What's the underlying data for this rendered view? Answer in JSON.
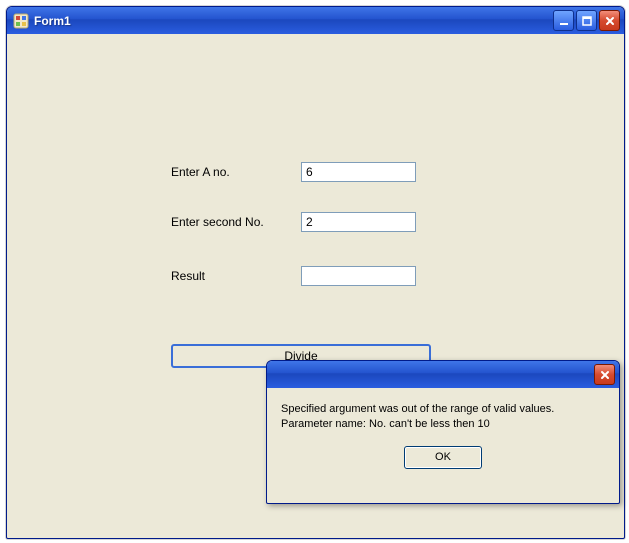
{
  "window": {
    "title": "Form1",
    "icons": {
      "app": "winforms-app-icon",
      "minimize": "minimize-icon",
      "maximize": "maximize-icon",
      "close": "close-icon"
    }
  },
  "form": {
    "rowA": {
      "label": "Enter A no.",
      "value": "6"
    },
    "rowB": {
      "label": "Enter second No.",
      "value": "2"
    },
    "rowResult": {
      "label": "Result",
      "value": ""
    },
    "divideButton": "Divide"
  },
  "messageBox": {
    "title": "",
    "line1": "Specified argument was out of the range of valid values.",
    "line2": "Parameter name: No. can't be less then 10",
    "ok": "OK",
    "closeIcon": "close-icon"
  }
}
